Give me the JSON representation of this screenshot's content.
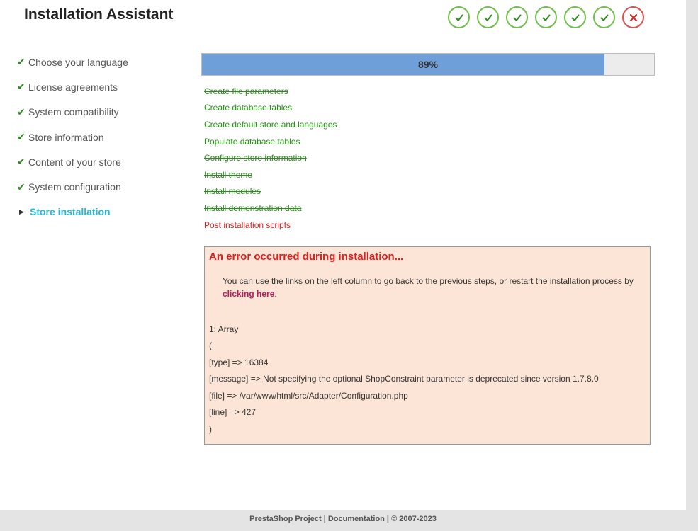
{
  "header": {
    "title": "Installation Assistant"
  },
  "step_icons": [
    "check-icon",
    "check-icon",
    "check-icon",
    "check-icon",
    "check-icon",
    "check-icon",
    "x-icon"
  ],
  "sidebar": {
    "items": [
      {
        "label": "Choose your language",
        "state": "done"
      },
      {
        "label": "License agreements",
        "state": "done"
      },
      {
        "label": "System compatibility",
        "state": "done"
      },
      {
        "label": "Store information",
        "state": "done"
      },
      {
        "label": "Content of your store",
        "state": "done"
      },
      {
        "label": "System configuration",
        "state": "done"
      },
      {
        "label": "Store installation",
        "state": "active"
      }
    ]
  },
  "progress": {
    "value": 0.89,
    "label": "89%"
  },
  "tasks": [
    {
      "label": "Create file parameters",
      "state": "done"
    },
    {
      "label": "Create database tables",
      "state": "done"
    },
    {
      "label": "Create default store and languages",
      "state": "done"
    },
    {
      "label": "Populate database tables",
      "state": "done"
    },
    {
      "label": "Configure store information",
      "state": "done"
    },
    {
      "label": "Install theme",
      "state": "done"
    },
    {
      "label": "Install modules",
      "state": "done"
    },
    {
      "label": "Install demonstration data",
      "state": "done"
    },
    {
      "label": "Post installation scripts",
      "state": "failed"
    }
  ],
  "error": {
    "title": "An error occurred during installation...",
    "message_before": "You can use the links on the left column to go back to the previous steps, or restart the installation process by ",
    "link": "clicking here",
    "message_after": ".",
    "debug_lines": [
      "1: Array",
      "(",
      "[type] => 16384",
      "[message] => Not specifying the optional ShopConstraint parameter is deprecated since version 1.7.8.0",
      "[file] => /var/www/html/src/Adapter/Configuration.php",
      "[line] => 427",
      ")"
    ]
  },
  "footer": {
    "text": "PrestaShop Project | Documentation | © 2007-2023"
  },
  "colors": {
    "success": "#2e8b1f",
    "active": "#25b9d7",
    "error": "#e02020",
    "progress_fill": "#6f9fd8",
    "error_bg": "#fce5d6"
  }
}
